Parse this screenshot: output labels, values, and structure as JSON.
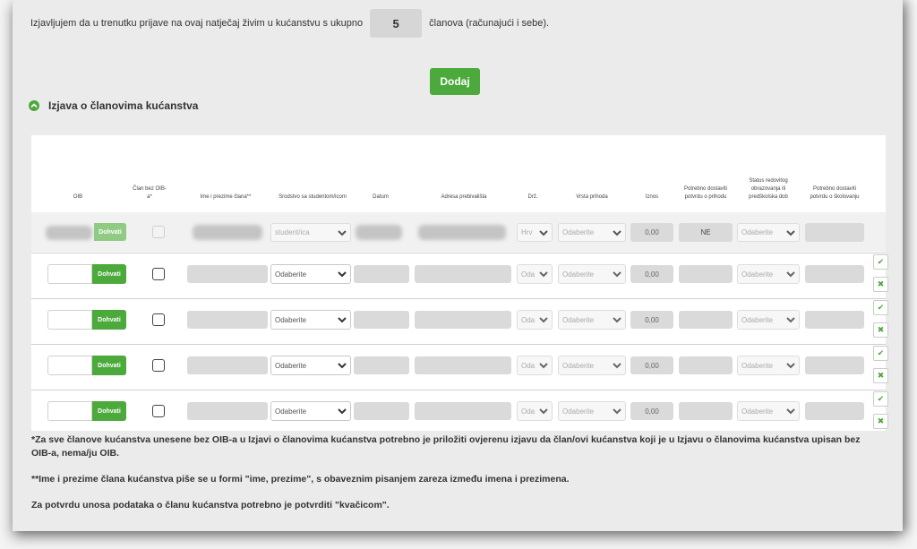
{
  "declaration": {
    "prefix": "Izjavljujem da u trenutku prijave na ovaj natječaj živim u kućanstvu s ukupno",
    "count": "5",
    "suffix": "članova (računajući i sebe)."
  },
  "add_button": "Dodaj",
  "section_title": "Izjava o članovima kućanstva",
  "table": {
    "headers": [
      "OIB",
      "Član bez OIB-a*",
      "Ime i prezime člana**",
      "Srodstvo sa studentom/icom",
      "Datum",
      "Adresa prebivališta",
      "Drž.",
      "Vrsta prihoda",
      "Iznos",
      "Potrebno dostaviti potvrdu o prihodu",
      "Status redovitog obrazovanja ili predškolska dob",
      "Potrebno dostaviti potvrdu o školovanju"
    ],
    "fetch_label": "Dohvati",
    "first_row": {
      "relation": "student/ica",
      "country": "Hrv",
      "income_type": "Odaberite",
      "amount": "0,00",
      "needs_proof": "NE",
      "education": "Odaberite"
    },
    "empty_row": {
      "relation": "Odaberite",
      "country": "Oda",
      "income_type": "Odaberite",
      "amount": "0,00",
      "education": "Odaberite"
    },
    "actions": {
      "confirm": "✔",
      "delete": "✖"
    }
  },
  "notes": [
    "*Za sve članove kućanstva unesene bez OIB-a u Izjavi o članovima kućanstva potrebno je priložiti ovjerenu izjavu da član/ovi kućanstva koji je u Izjavu o članovima kućanstva upisan bez OIB-a, nema/ju OIB.",
    "**Ime i prezime člana kućanstva piše se u formi \"ime, prezime\", s obaveznim pisanjem zareza između imena i prezimena.",
    "Za potvrdu unosa podataka o članu kućanstva potrebno je potvrditi \"kvačicom\"."
  ],
  "colors": {
    "accent": "#4caa3c",
    "field": "#dadada"
  }
}
